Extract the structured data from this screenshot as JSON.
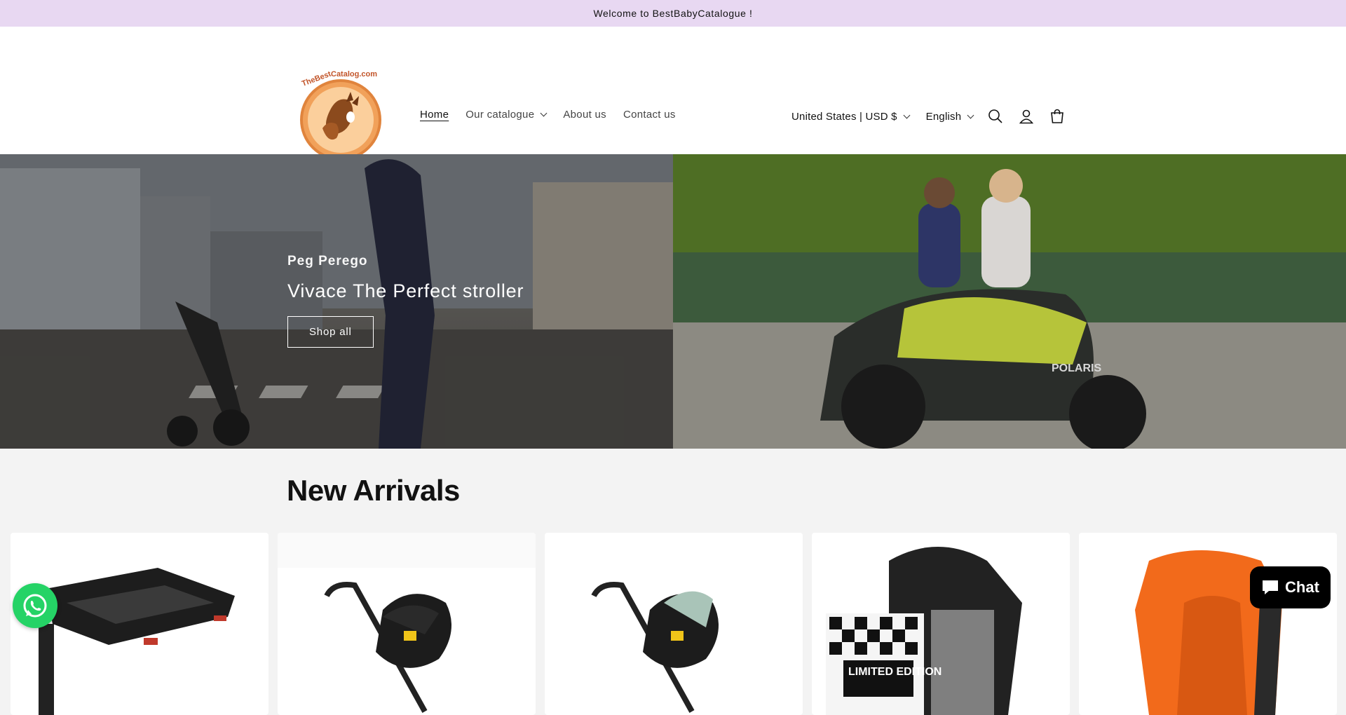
{
  "announcement": "Welcome to BestBabyCatalogue !",
  "logo": {
    "text": "TheBestbabyCatalog.com",
    "icon": "deer-logo"
  },
  "nav": {
    "items": [
      {
        "label": "Home",
        "active": true
      },
      {
        "label": "Our catalogue",
        "dropdown": true
      },
      {
        "label": "About us"
      },
      {
        "label": "Contact us"
      }
    ]
  },
  "header": {
    "country_selector": "United States | USD $",
    "language_selector": "English",
    "icons": [
      "search-icon",
      "account-icon",
      "cart-icon"
    ]
  },
  "hero": {
    "subtitle": "Peg Perego",
    "title": "Vivace The Perfect stroller",
    "button": "Shop all"
  },
  "section": {
    "title": "New Arrivals"
  },
  "products": [
    {
      "image": "isofix-base"
    },
    {
      "image": "black-stroller-car-seat"
    },
    {
      "image": "mint-stroller-car-seat"
    },
    {
      "image": "booster-seat-limited-edition",
      "badge": "LIMITED EDITION"
    },
    {
      "image": "orange-booster-seat"
    }
  ],
  "chat": {
    "label": "Chat"
  },
  "colors": {
    "announcement_bg": "#e8d8f2",
    "chat_bg": "#000000",
    "whatsapp": "#25d366"
  }
}
